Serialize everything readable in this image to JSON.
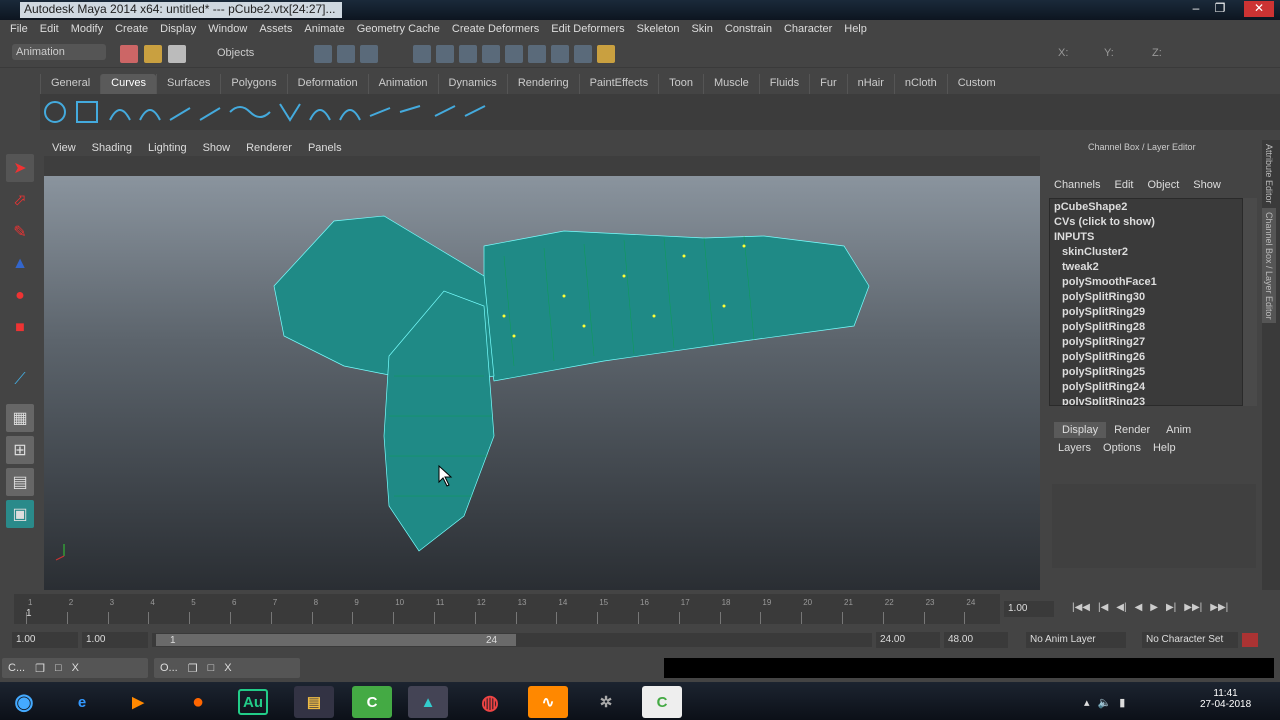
{
  "window": {
    "title": "Autodesk Maya 2014 x64: untitled*   ---   pCube2.vtx[24:27]...",
    "min": "–",
    "max": "❐",
    "close": "✕"
  },
  "menu": [
    "File",
    "Edit",
    "Modify",
    "Create",
    "Display",
    "Window",
    "Assets",
    "Animate",
    "Geometry Cache",
    "Create Deformers",
    "Edit Deformers",
    "Skeleton",
    "Skin",
    "Constrain",
    "Character",
    "Help"
  ],
  "status": {
    "mode": "Animation",
    "objects": "Objects",
    "x_label": "X:",
    "y_label": "Y:",
    "z_label": "Z:"
  },
  "shelf_tabs": [
    "General",
    "Curves",
    "Surfaces",
    "Polygons",
    "Deformation",
    "Animation",
    "Dynamics",
    "Rendering",
    "PaintEffects",
    "Toon",
    "Muscle",
    "Fluids",
    "Fur",
    "nHair",
    "nCloth",
    "Custom"
  ],
  "panel_menu": [
    "View",
    "Shading",
    "Lighting",
    "Show",
    "Renderer",
    "Panels"
  ],
  "channel_box": {
    "title": "Channel Box / Layer Editor",
    "menu": [
      "Channels",
      "Edit",
      "Object",
      "Show"
    ],
    "items": [
      "pCubeShape2",
      "CVs (click to show)",
      "INPUTS",
      "skinCluster2",
      "tweak2",
      "polySmoothFace1",
      "polySplitRing30",
      "polySplitRing29",
      "polySplitRing28",
      "polySplitRing27",
      "polySplitRing26",
      "polySplitRing25",
      "polySplitRing24",
      "polySplitRing23"
    ],
    "layer_tabs": [
      "Display",
      "Render",
      "Anim"
    ],
    "layer_menu": [
      "Layers",
      "Options",
      "Help"
    ]
  },
  "side_tabs": [
    "Attribute Editor",
    "Channel Box / Layer Editor"
  ],
  "timeline": {
    "ticks": [
      "1",
      "2",
      "3",
      "4",
      "5",
      "6",
      "7",
      "8",
      "9",
      "10",
      "11",
      "12",
      "13",
      "14",
      "15",
      "16",
      "17",
      "18",
      "19",
      "20",
      "21",
      "22",
      "23",
      "24"
    ],
    "current": "1",
    "current_field": "1.00"
  },
  "range": {
    "start": "1.00",
    "inner_start": "1.00",
    "slider_start": "1",
    "slider_end": "24",
    "end": "24.00",
    "anim_end": "48.00",
    "anim_layer": "No Anim Layer",
    "char_set": "No Character Set"
  },
  "playback": [
    "|◀◀",
    "|◀",
    "◀|",
    "◀",
    "▶",
    "▶|",
    "▶▶|",
    "▶▶|"
  ],
  "minimized": [
    {
      "label": "C...",
      "b1": "❐",
      "b2": "□",
      "b3": "X"
    },
    {
      "label": "O...",
      "b1": "❐",
      "b2": "□",
      "b3": "X"
    }
  ],
  "taskbar": {
    "time": "11:41",
    "date": "27-04-2018",
    "apps": [
      "Au",
      "C",
      "C"
    ]
  }
}
